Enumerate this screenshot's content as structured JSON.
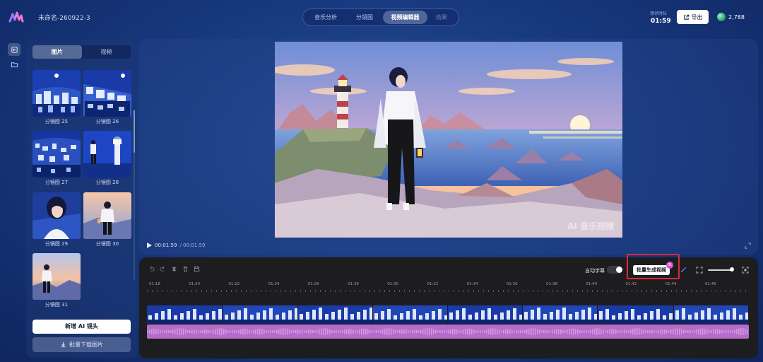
{
  "header": {
    "project_name": "未命名-260922-3",
    "tabs": [
      {
        "label": "音乐分析",
        "state": "normal"
      },
      {
        "label": "分镜图",
        "state": "normal"
      },
      {
        "label": "视频编辑器",
        "state": "active"
      },
      {
        "label": "结果",
        "state": "disabled"
      }
    ],
    "duration_label": "预计时长",
    "duration_value": "01:59",
    "export_label": "导出",
    "credits": "2,788"
  },
  "left_panel": {
    "segments": [
      {
        "label": "图片",
        "active": true
      },
      {
        "label": "视频",
        "active": false
      }
    ],
    "thumbnails": [
      {
        "label": "分镜图 25",
        "scene": "night-city"
      },
      {
        "label": "分镜图 26",
        "scene": "night-city"
      },
      {
        "label": "分镜图 27",
        "scene": "night-city"
      },
      {
        "label": "分镜图 28",
        "scene": "lighthouse-night"
      },
      {
        "label": "分镜图 29",
        "scene": "girl-portrait"
      },
      {
        "label": "分镜图 30",
        "scene": "girl-sunset"
      },
      {
        "label": "分镜图 31",
        "scene": "girl-sunset"
      }
    ],
    "add_button": "新增 AI 镜头",
    "download_button": "批量下载图片"
  },
  "preview": {
    "watermark": "AI 音乐视频",
    "time_current": "00:01:59",
    "time_total": "/ 00:01:59"
  },
  "timeline": {
    "auto_subtitle_label": "自动字幕",
    "auto_subtitle_on": true,
    "batch_button": "批量生成视频",
    "batch_badge": "01",
    "ruler": [
      "01:18",
      "01:20",
      "01:22",
      "01:24",
      "01:26",
      "01:28",
      "01:30",
      "01:32",
      "01:34",
      "01:36",
      "01:38",
      "01:40",
      "01:42",
      "01:44",
      "01:46"
    ]
  },
  "colors": {
    "accent_magenta": "#d94fd6",
    "audio_track": "#b56bc8",
    "highlight_red": "#e0283a"
  }
}
